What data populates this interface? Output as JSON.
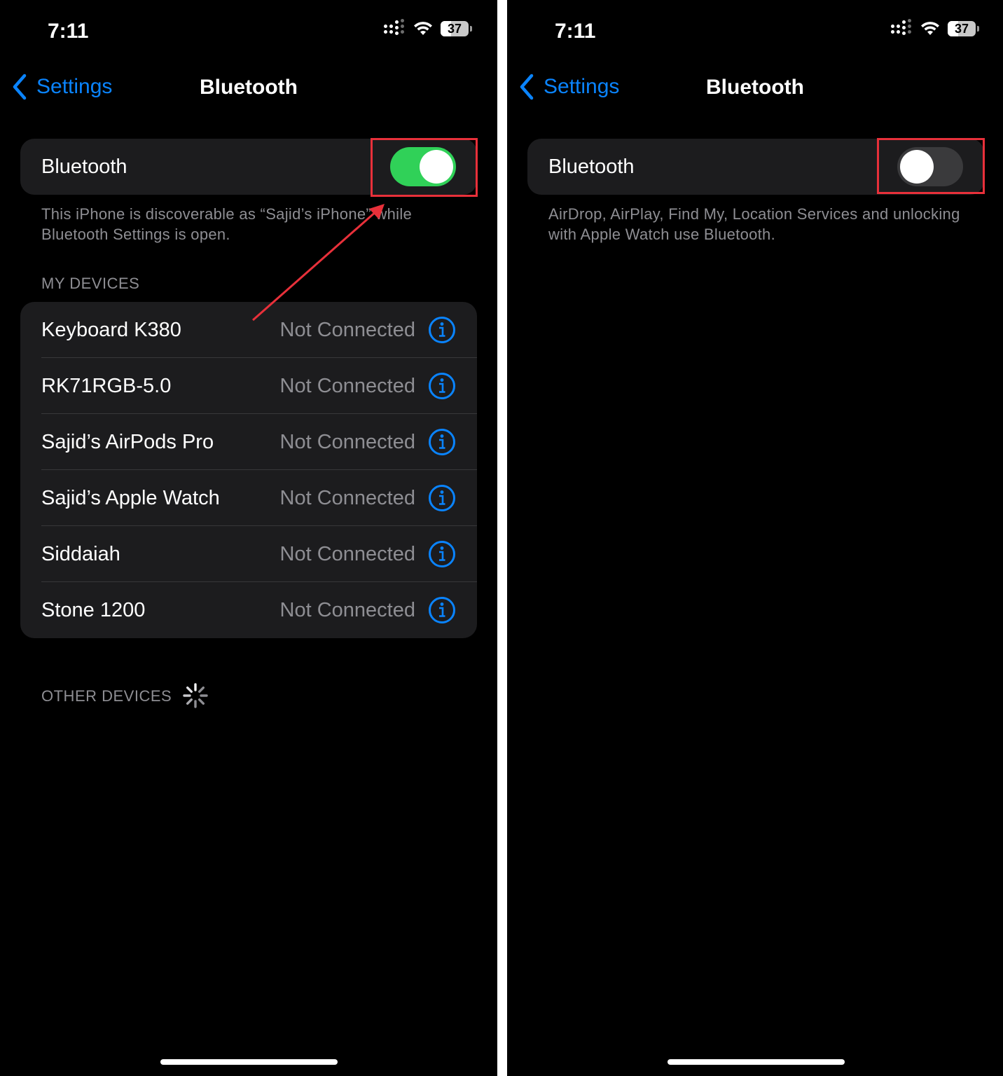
{
  "left": {
    "status_bar": {
      "time": "7:11",
      "battery": "37"
    },
    "nav": {
      "back_label": "Settings",
      "title": "Bluetooth"
    },
    "bluetooth_toggle": {
      "label": "Bluetooth",
      "state": "on"
    },
    "footnote": "This iPhone is discoverable as “Sajid’s iPhone” while Bluetooth Settings is open.",
    "my_devices_header": "MY DEVICES",
    "devices": [
      {
        "name": "Keyboard K380",
        "status": "Not Connected"
      },
      {
        "name": "RK71RGB-5.0",
        "status": "Not Connected"
      },
      {
        "name": "Sajid’s AirPods Pro",
        "status": "Not Connected"
      },
      {
        "name": "Sajid’s Apple Watch",
        "status": "Not Connected"
      },
      {
        "name": "Siddaiah",
        "status": "Not Connected"
      },
      {
        "name": "Stone 1200",
        "status": "Not Connected"
      }
    ],
    "other_devices_header": "OTHER DEVICES"
  },
  "right": {
    "status_bar": {
      "time": "7:11",
      "battery": "37"
    },
    "nav": {
      "back_label": "Settings",
      "title": "Bluetooth"
    },
    "bluetooth_toggle": {
      "label": "Bluetooth",
      "state": "off"
    },
    "footnote": "AirDrop, AirPlay, Find My, Location Services and unlocking with Apple Watch use Bluetooth."
  },
  "colors": {
    "accent_blue": "#0a84ff",
    "toggle_on": "#30d158",
    "toggle_off": "#3a3a3c",
    "annotation_red": "#e8303a",
    "cell_bg": "#1c1c1e",
    "secondary_text": "#8e8e93"
  },
  "icons": {
    "back": "chevron-left-icon",
    "info": "info-circle-icon",
    "signal": "cellular-signal-icon",
    "wifi": "wifi-icon",
    "battery": "battery-icon",
    "spinner": "activity-spinner-icon"
  }
}
